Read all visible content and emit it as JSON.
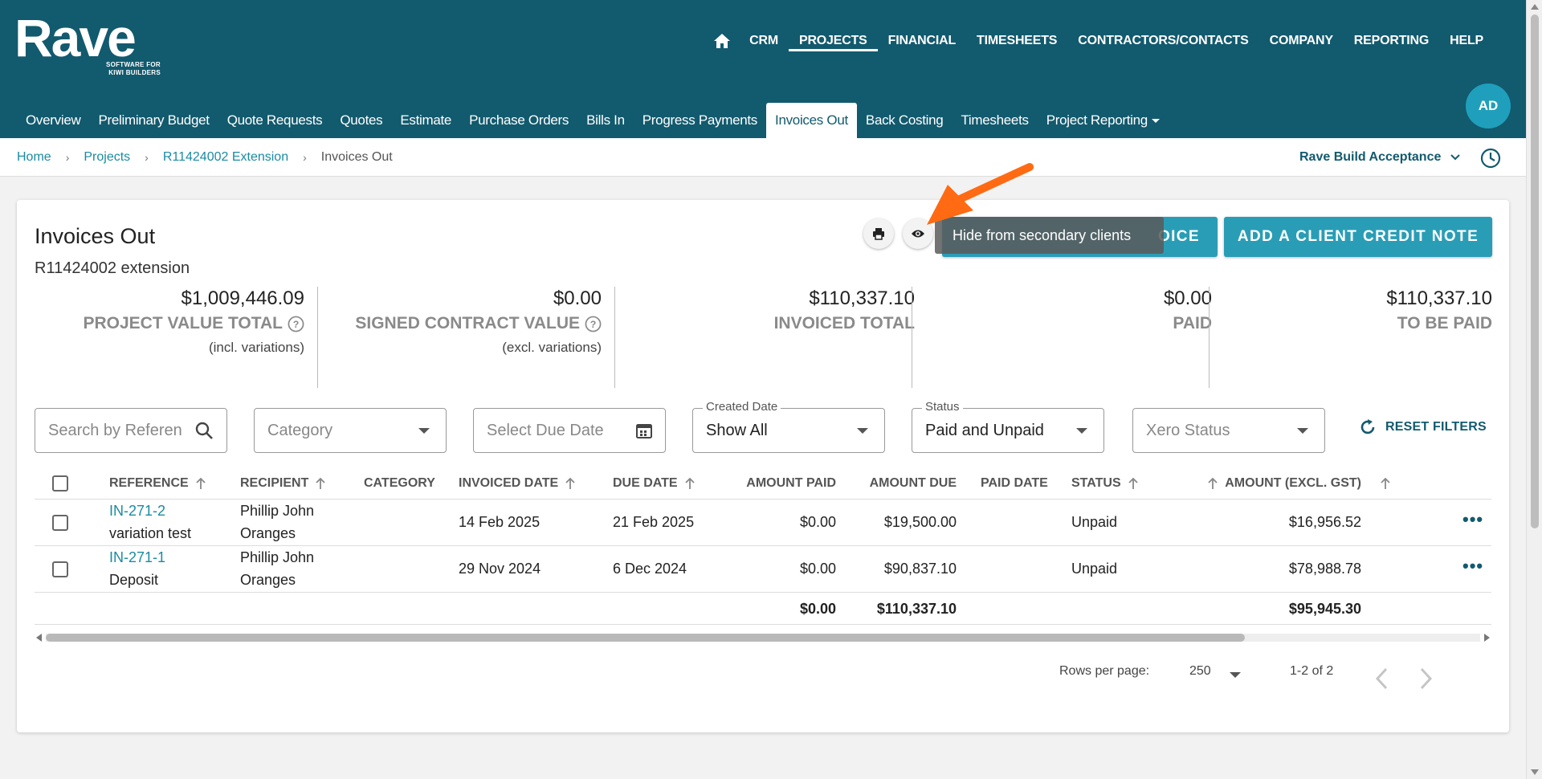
{
  "brand": {
    "name": "Rave",
    "tagline_line1": "SOFTWARE FOR",
    "tagline_line2": "KIWI BUILDERS"
  },
  "main_nav": [
    {
      "label": "CRM"
    },
    {
      "label": "PROJECTS",
      "active": true
    },
    {
      "label": "FINANCIAL"
    },
    {
      "label": "TIMESHEETS"
    },
    {
      "label": "CONTRACTORS/CONTACTS"
    },
    {
      "label": "COMPANY"
    },
    {
      "label": "REPORTING"
    },
    {
      "label": "HELP"
    }
  ],
  "sub_nav": [
    {
      "label": "Overview"
    },
    {
      "label": "Preliminary Budget"
    },
    {
      "label": "Quote Requests"
    },
    {
      "label": "Quotes"
    },
    {
      "label": "Estimate"
    },
    {
      "label": "Purchase Orders"
    },
    {
      "label": "Bills In"
    },
    {
      "label": "Progress Payments"
    },
    {
      "label": "Invoices Out",
      "active": true
    },
    {
      "label": "Back Costing"
    },
    {
      "label": "Timesheets"
    },
    {
      "label": "Project Reporting"
    }
  ],
  "user": {
    "initials": "AD"
  },
  "breadcrumb": [
    {
      "label": "Home"
    },
    {
      "label": "Projects"
    },
    {
      "label": "R11424002 Extension"
    },
    {
      "label": "Invoices Out"
    }
  ],
  "company": {
    "selected": "Rave Build Acceptance"
  },
  "page": {
    "title": "Invoices Out",
    "subtitle": "R11424002 extension",
    "tooltip": "Hide from secondary clients",
    "add_invoice_label": "OICE",
    "add_credit_note_label": "ADD A CLIENT CREDIT NOTE"
  },
  "summary": {
    "project_value": {
      "value": "$1,009,446.09",
      "label": "PROJECT VALUE TOTAL",
      "note": "(incl. variations)"
    },
    "signed_contract": {
      "value": "$0.00",
      "label": "SIGNED CONTRACT VALUE",
      "note": "(excl. variations)"
    },
    "invoiced": {
      "value": "$110,337.10",
      "label": "INVOICED TOTAL"
    },
    "paid": {
      "value": "$0.00",
      "label": "PAID"
    },
    "to_be_paid": {
      "value": "$110,337.10",
      "label": "TO BE PAID"
    }
  },
  "filters": {
    "search_placeholder": "Search by Reference",
    "category_placeholder": "Category",
    "due_date_placeholder": "Select Due Date",
    "created_date": {
      "legend": "Created Date",
      "value": "Show All"
    },
    "status": {
      "legend": "Status",
      "value": "Paid and Unpaid"
    },
    "xero_placeholder": "Xero Status",
    "reset_label": "RESET FILTERS"
  },
  "table": {
    "columns": {
      "reference": "REFERENCE",
      "recipient": "RECIPIENT",
      "category": "CATEGORY",
      "invoiced_date": "INVOICED DATE",
      "due_date": "DUE DATE",
      "amount_paid": "AMOUNT PAID",
      "amount_due": "AMOUNT DUE",
      "paid_date": "PAID DATE",
      "status": "STATUS",
      "amount_excl_gst": "AMOUNT (EXCL. GST)"
    },
    "rows": [
      {
        "reference": "IN-271-2",
        "description": "variation test",
        "recipient_line1": "Phillip John",
        "recipient_line2": "Oranges",
        "invoiced_date": "14 Feb 2025",
        "due_date": "21 Feb 2025",
        "amount_paid": "$0.00",
        "amount_due": "$19,500.00",
        "status": "Unpaid",
        "amount_excl_gst": "$16,956.52"
      },
      {
        "reference": "IN-271-1",
        "description": "Deposit",
        "recipient_line1": "Phillip John",
        "recipient_line2": "Oranges",
        "invoiced_date": "29 Nov 2024",
        "due_date": "6 Dec 2024",
        "amount_paid": "$0.00",
        "amount_due": "$90,837.10",
        "status": "Unpaid",
        "amount_excl_gst": "$78,988.78"
      }
    ],
    "totals": {
      "amount_paid": "$0.00",
      "amount_due": "$110,337.10",
      "amount_excl_gst": "$95,945.30"
    }
  },
  "pagination": {
    "rows_per_page_label": "Rows per page:",
    "rows_per_page": "250",
    "range": "1-2 of 2"
  },
  "colors": {
    "header": "#125a6e",
    "accent": "#2a9db6",
    "link": "#1a8ba3",
    "callout": "#ff6a13"
  }
}
